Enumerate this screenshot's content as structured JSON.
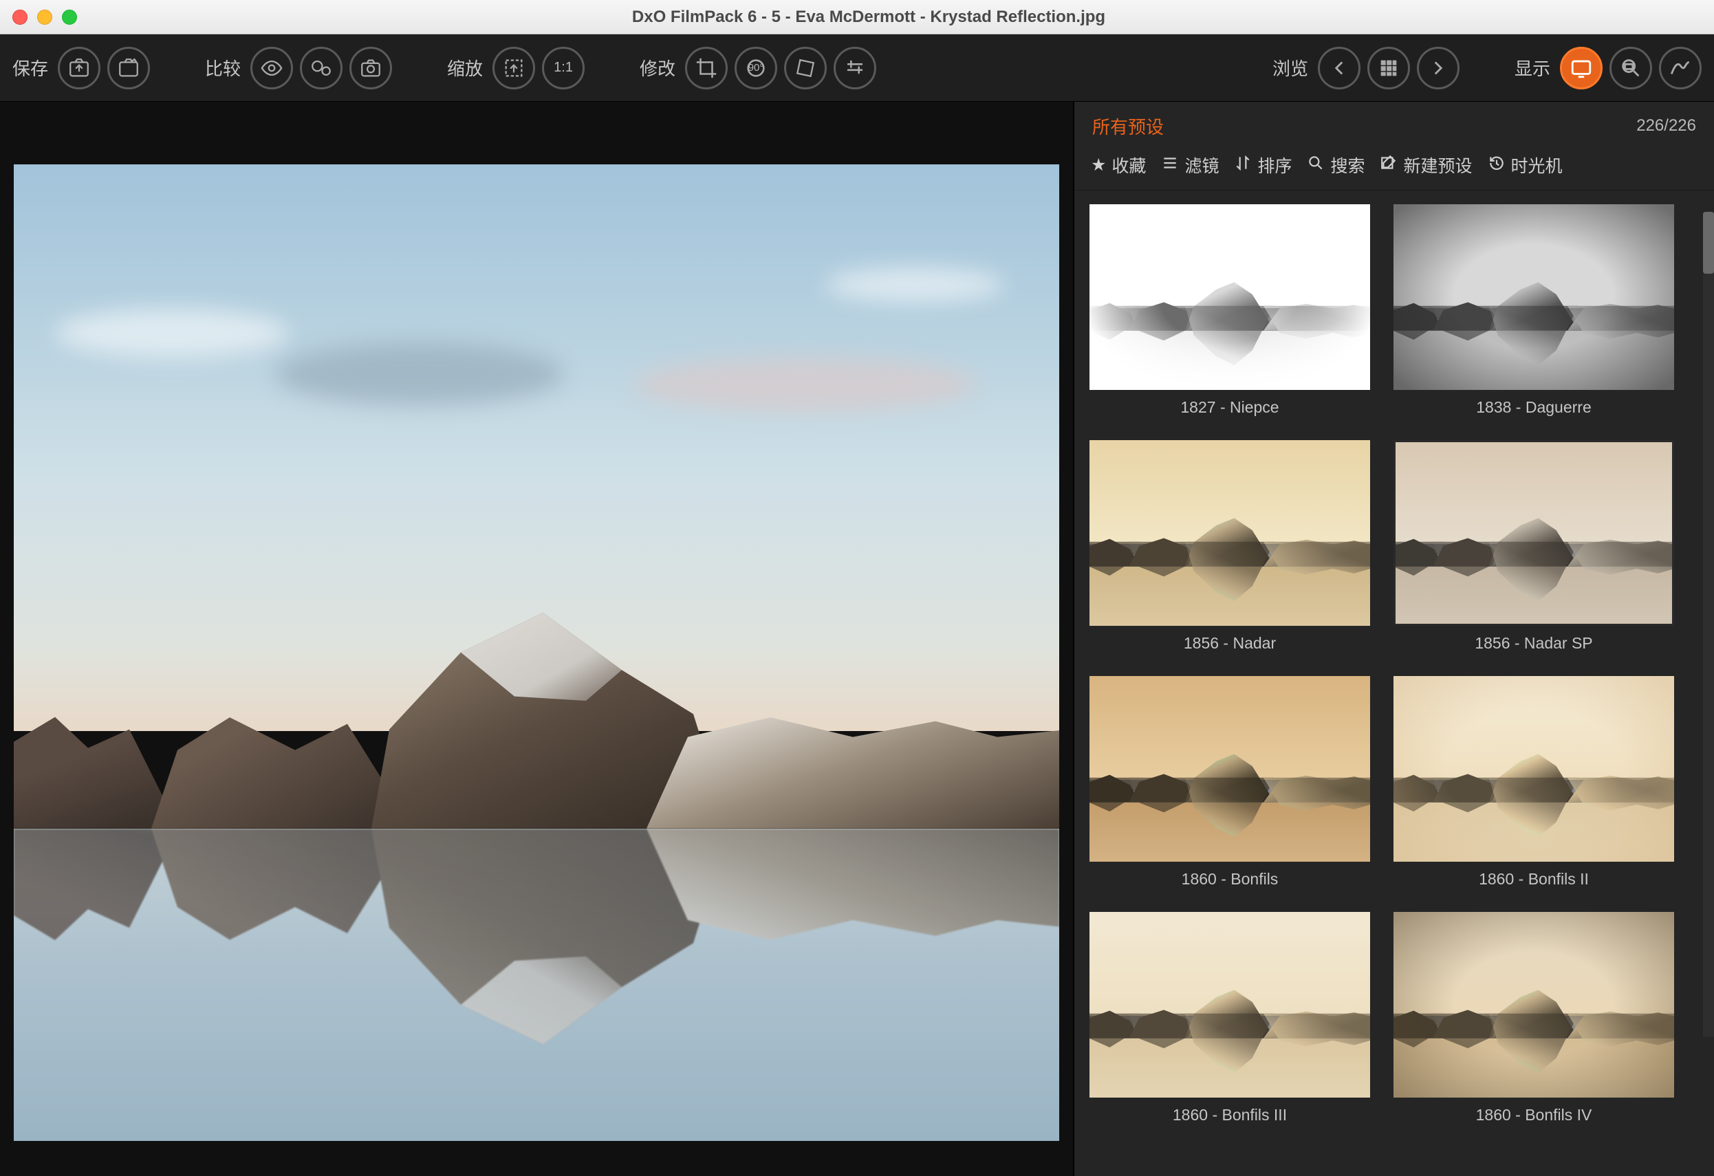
{
  "window": {
    "title": "DxO FilmPack 6 - 5 - Eva McDermott - Krystad Reflection.jpg"
  },
  "toolbar": {
    "save": "保存",
    "compare": "比较",
    "zoom": "缩放",
    "zoom_11": "1:1",
    "rotate_90": "90°",
    "edit": "修改",
    "browse": "浏览",
    "show": "显示"
  },
  "panel": {
    "title": "所有预设",
    "count": "226/226",
    "filters": {
      "favorites": "收藏",
      "filter": "滤镜",
      "sort": "排序",
      "search": "搜索",
      "new_preset": "新建预设",
      "time_machine": "时光机"
    }
  },
  "presets": [
    {
      "id": "niepce",
      "label": "1827 - Niepce",
      "variant": "v-niepce"
    },
    {
      "id": "daguerre",
      "label": "1838 - Daguerre",
      "variant": "v-daguerre"
    },
    {
      "id": "nadar",
      "label": "1856 - Nadar",
      "variant": "v-nadar"
    },
    {
      "id": "nadarsp",
      "label": "1856 - Nadar SP",
      "variant": "v-nadarsp"
    },
    {
      "id": "bonfils",
      "label": "1860 - Bonfils",
      "variant": "v-bonfils"
    },
    {
      "id": "bonfils2",
      "label": "1860 - Bonfils II",
      "variant": "v-bonfils2"
    },
    {
      "id": "bonfils3",
      "label": "1860 - Bonfils III",
      "variant": "v-bonfils3"
    },
    {
      "id": "bonfils4",
      "label": "1860 - Bonfils IV",
      "variant": "v-bonfils4"
    }
  ]
}
